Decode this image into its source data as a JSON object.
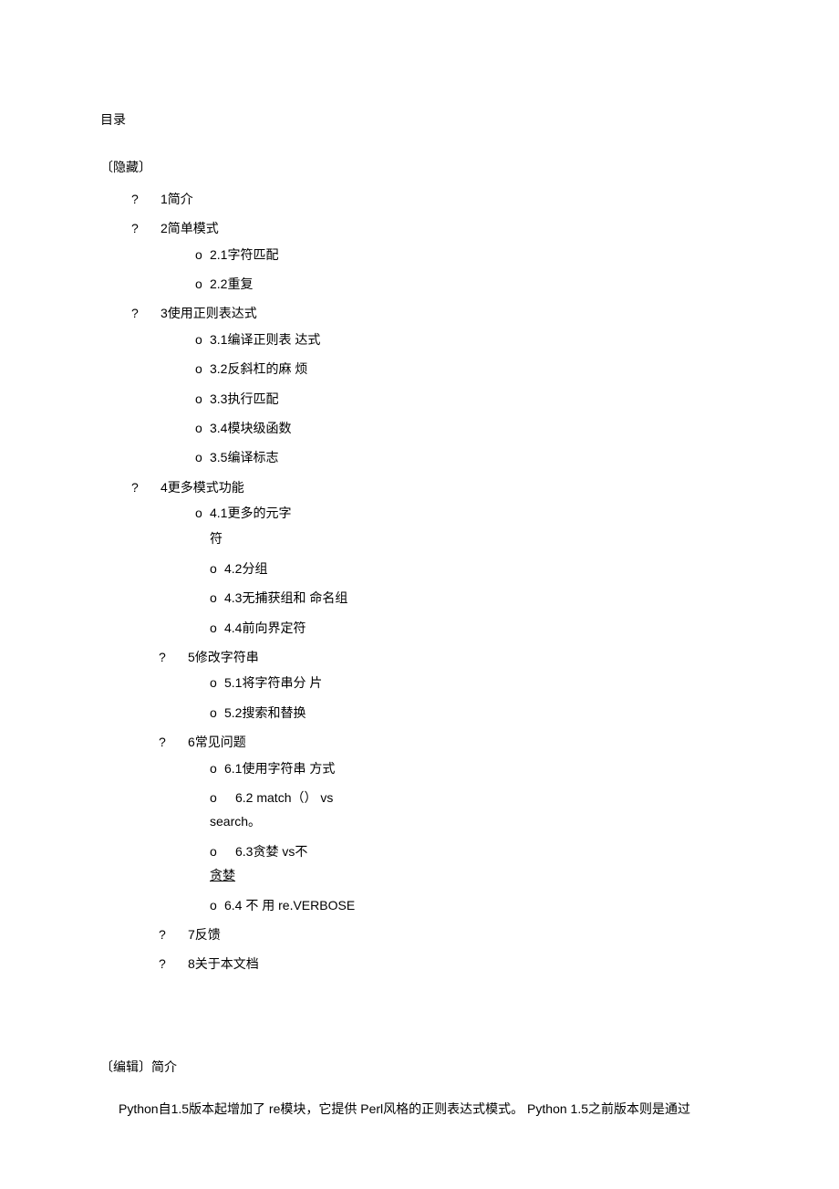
{
  "toc_title": "目录",
  "toc_hide": "〔隐藏〕",
  "bullet_q": "?",
  "bullet_o": "o",
  "items": [
    {
      "label": "1简介"
    },
    {
      "label": "2简单模式",
      "children": [
        {
          "label": "2.1字符匹配"
        },
        {
          "label": "2.2重复"
        }
      ]
    },
    {
      "label": "3使用正则表达式",
      "children": [
        {
          "label": "3.1编译正则表 达式"
        },
        {
          "label": "3.2反斜杠的麻 烦"
        },
        {
          "label": "3.3执行匹配"
        },
        {
          "label": "3.4模块级函数"
        },
        {
          "label": "3.5编译标志"
        }
      ]
    },
    {
      "label": "4更多模式功能",
      "children": [
        {
          "label": "4.1更多的元字",
          "wrap": "符",
          "sub_below": [
            {
              "label": "4.2分组"
            },
            {
              "label": "4.3无捕获组和 命名组"
            },
            {
              "label": "4.4前向界定符"
            }
          ]
        }
      ]
    },
    {
      "label_indent": true,
      "label": "5修改字符串",
      "children_indent": true,
      "children": [
        {
          "label": "5.1将字符串分 片"
        },
        {
          "label": "5.2搜索和替换"
        }
      ]
    },
    {
      "label_indent": true,
      "label": "6常见问题",
      "children_indent": true,
      "children": [
        {
          "label": "6.1使用字符串 方式"
        },
        {
          "wide": true,
          "label": "6.2 match（） vs",
          "wrap_plain": "search。"
        },
        {
          "wide": true,
          "label": "6.3贪婪 vs不",
          "wrap_underline": "贪婪"
        },
        {
          "label": "6.4 不 用 re.VERBOSE"
        }
      ]
    },
    {
      "label_indent": true,
      "label": "7反馈"
    },
    {
      "label_indent": true,
      "label": "8关于本文档"
    }
  ],
  "edit_heading": "〔编辑〕简介",
  "body_text": "Python自1.5版本起增加了 re模块，它提供 Perl风格的正则表达式模式。 Python 1.5之前版本则是通过"
}
